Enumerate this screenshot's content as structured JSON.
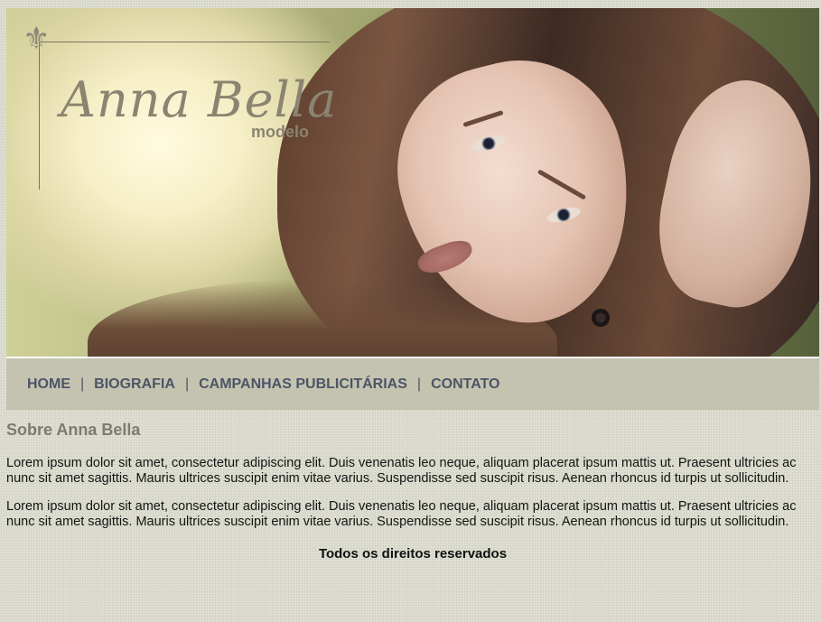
{
  "header": {
    "logo": {
      "fleur_glyph": "⚜",
      "name": "Anna Bella",
      "subtitle": "modelo"
    },
    "banner_image": "portrait-photo"
  },
  "nav": {
    "items": [
      {
        "label": "HOME"
      },
      {
        "label": "BIOGRAFIA"
      },
      {
        "label": "CAMPANHAS PUBLICITÁRIAS"
      },
      {
        "label": "CONTATO"
      }
    ],
    "separator": "|"
  },
  "main": {
    "heading": "Sobre Anna Bella",
    "paragraphs": [
      "Lorem ipsum dolor sit amet, consectetur adipiscing elit. Duis venenatis leo neque, aliquam placerat ipsum mattis ut. Praesent ultricies ac nunc sit amet sagittis. Mauris ultrices suscipit enim vitae varius. Suspendisse sed suscipit risus. Aenean rhoncus id turpis ut sollicitudin.",
      "Lorem ipsum dolor sit amet, consectetur adipiscing elit. Duis venenatis leo neque, aliquam placerat ipsum mattis ut. Praesent ultricies ac nunc sit amet sagittis. Mauris ultrices suscipit enim vitae varius. Suspendisse sed suscipit risus. Aenean rhoncus id turpis ut sollicitudin."
    ]
  },
  "footer": {
    "text": "Todos os direitos reservados"
  },
  "colors": {
    "nav_bg": "#c4c3b0",
    "nav_text": "#4c5566",
    "heading": "#7d7b6f",
    "page_bg": "#dcdcd0"
  }
}
